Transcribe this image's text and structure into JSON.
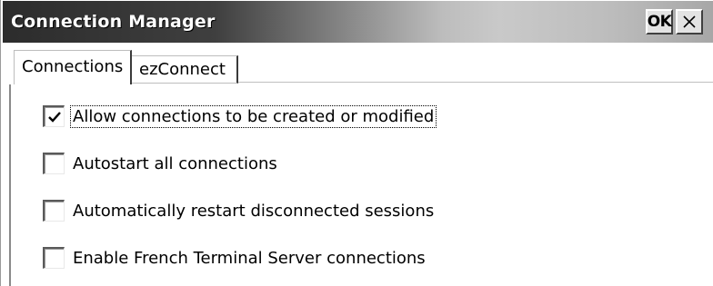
{
  "window": {
    "title": "Connection Manager",
    "ok_label": "OK"
  },
  "tabs": [
    {
      "label": "Connections",
      "selected": true
    },
    {
      "label": "ezConnect",
      "selected": false
    }
  ],
  "options": [
    {
      "label": "Allow connections to be created or modified",
      "checked": true,
      "focused": true
    },
    {
      "label": "Autostart all connections",
      "checked": false
    },
    {
      "label": "Automatically restart disconnected sessions",
      "checked": false
    },
    {
      "label": "Enable French Terminal Server connections",
      "checked": false
    }
  ],
  "icons": {
    "close": "close-icon",
    "check": "checkmark-icon"
  }
}
